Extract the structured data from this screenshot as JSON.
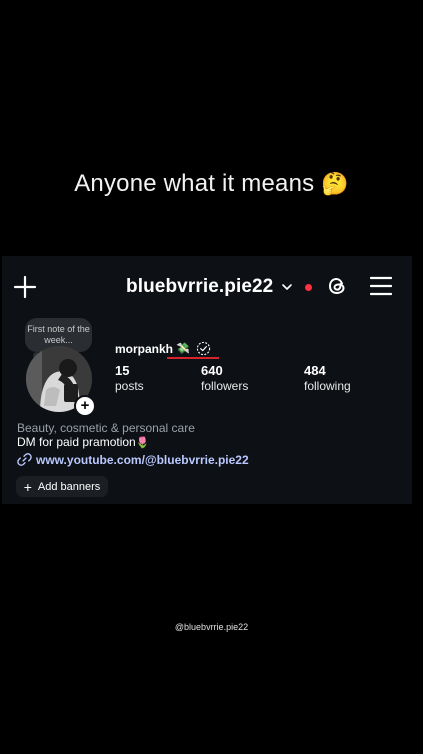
{
  "caption": {
    "text": "Anyone what it means",
    "emoji": "🤔"
  },
  "header": {
    "username": "bluebvrrie.pie22",
    "has_notification_dot": true,
    "plus_icon": "plus-icon",
    "threads_icon": "threads-icon",
    "menu_icon": "hamburger-menu-icon"
  },
  "profile": {
    "note": "First note of the week...",
    "display_name": "morpankh",
    "display_name_emoji": "💸",
    "verified_icon": "dashed-check-circle-icon",
    "stats": [
      {
        "value": "15",
        "label": "posts"
      },
      {
        "value": "640",
        "label": "followers"
      },
      {
        "value": "484",
        "label": "following"
      }
    ],
    "category": "Beauty, cosmetic & personal care",
    "bio": "DM for paid pramotion",
    "bio_emoji": "🌷",
    "link": "www.youtube.com/@bluebvrrie.pie22",
    "add_banners_label": "Add banners"
  },
  "watermark": "@bluebvrrie.pie22",
  "colors": {
    "background": "#000000",
    "panel": "#0d1015",
    "link": "#b9c8ff",
    "notification_dot": "#ff3040",
    "annotation_underline": "#d8232a"
  }
}
